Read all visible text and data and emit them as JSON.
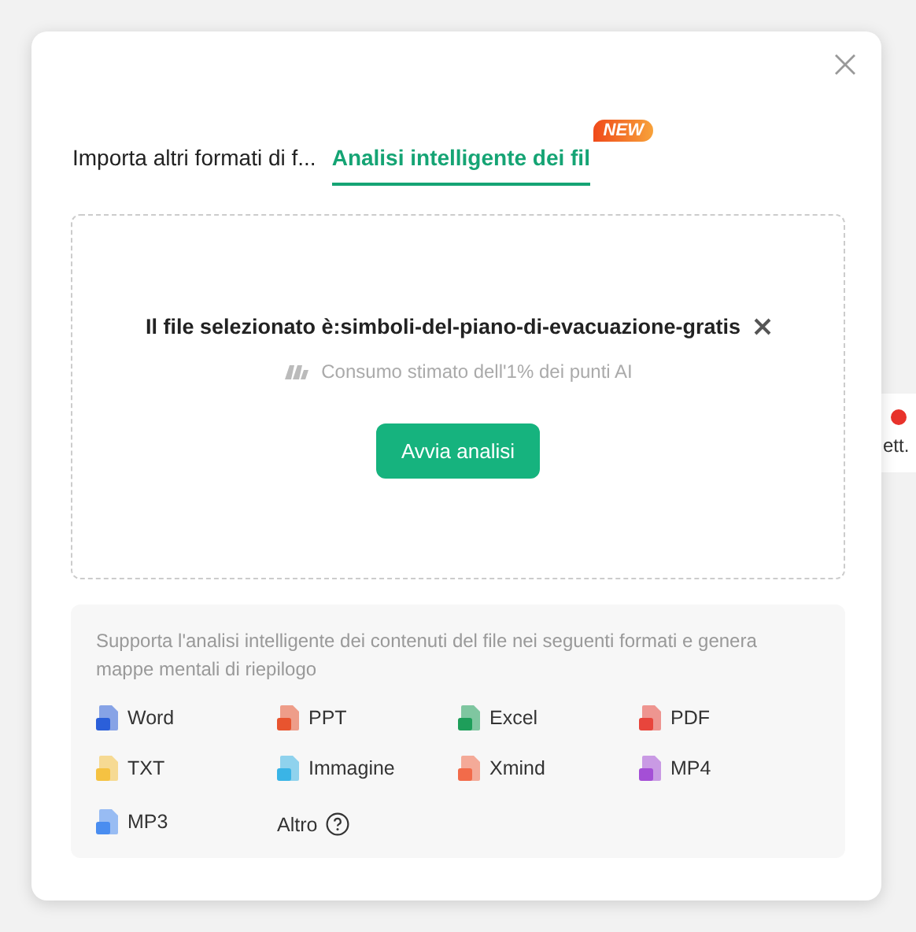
{
  "tabs": [
    {
      "label": "Importa altri formati di f...",
      "selected": false
    },
    {
      "label": "Analisi intelligente dei fil",
      "selected": true,
      "badge": "NEW"
    }
  ],
  "upload": {
    "file_label": "Il file selezionato è:simboli-del-piano-di-evacuazione-gratis",
    "cost_note": "Consumo stimato dell'1% dei punti AI",
    "action": "Avvia analisi"
  },
  "formats": {
    "description": "Supporta l'analisi intelligente dei contenuti del file nei seguenti formati e genera mappe mentali di riepilogo",
    "items": [
      {
        "label": "Word",
        "kind": "file",
        "color": "#2b5fd9"
      },
      {
        "label": "PPT",
        "kind": "file",
        "color": "#e8542f"
      },
      {
        "label": "Excel",
        "kind": "file",
        "color": "#1e9e5a"
      },
      {
        "label": "PDF",
        "kind": "file",
        "color": "#e8453c"
      },
      {
        "label": "TXT",
        "kind": "file",
        "color": "#f5c242"
      },
      {
        "label": "Immagine",
        "kind": "file",
        "color": "#3ab4e6"
      },
      {
        "label": "Xmind",
        "kind": "file",
        "color": "#f26b4a"
      },
      {
        "label": "MP4",
        "kind": "file",
        "color": "#a44fd6"
      },
      {
        "label": "MP3",
        "kind": "file",
        "color": "#4a8df0"
      },
      {
        "label": "Altro",
        "kind": "more"
      }
    ]
  },
  "background_fragment": {
    "label": "ett."
  }
}
